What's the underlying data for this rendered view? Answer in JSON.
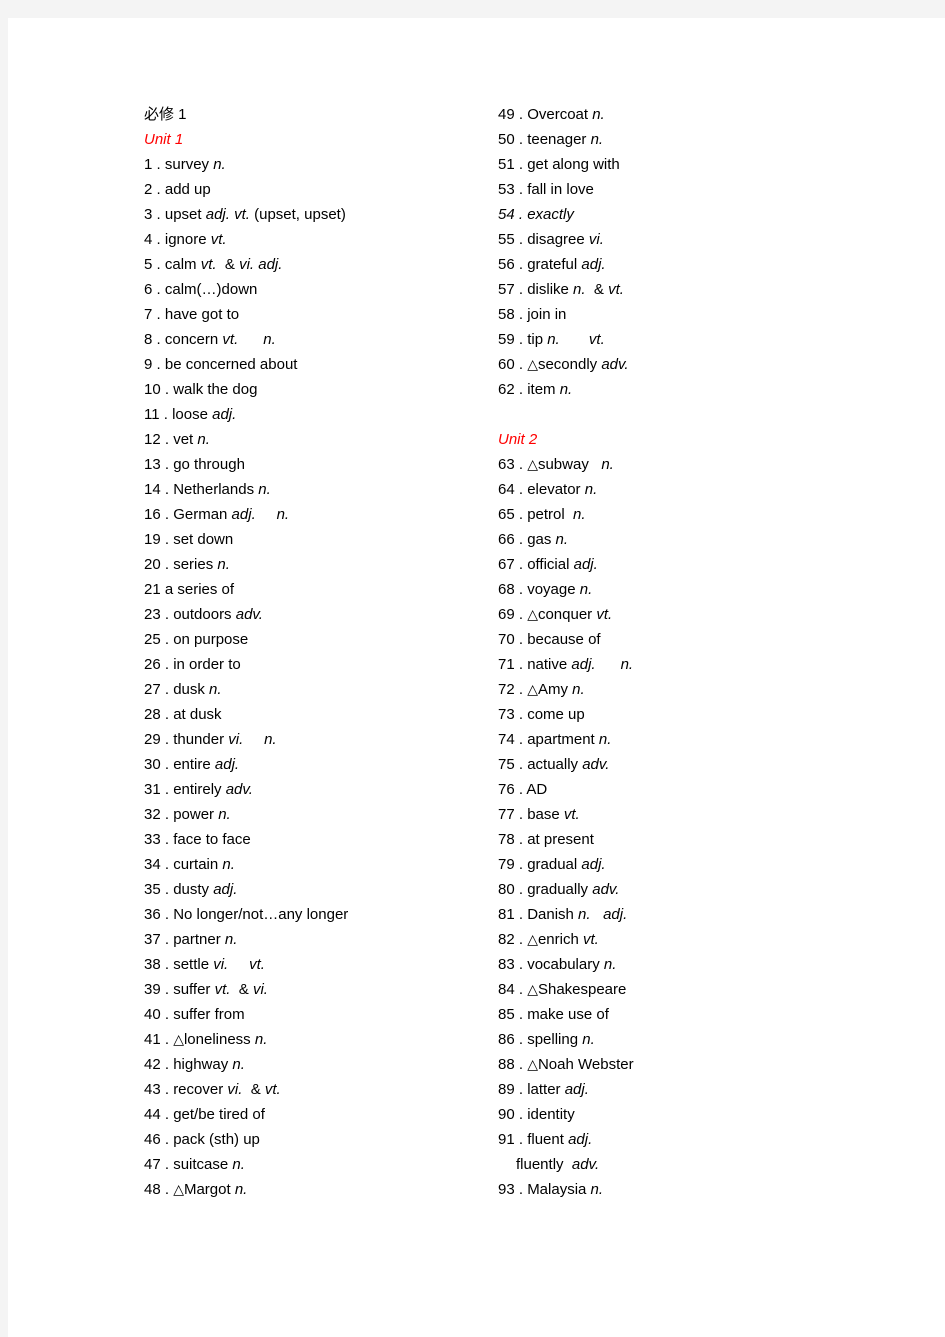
{
  "document": {
    "title": "必修 1",
    "accent_color": "#ff0000",
    "text_color": "#000000",
    "page_background": "#ffffff",
    "margin_background": "#f4f4f4",
    "marker_glyph": "△",
    "marker_meaning": "triangle-marker-icon"
  },
  "columns": {
    "left": {
      "unit_heading": "Unit 1",
      "entries": [
        {
          "num": "1",
          "sep": ".",
          "text": "survey n."
        },
        {
          "num": "2",
          "sep": ".",
          "text": "add up"
        },
        {
          "num": "3",
          "sep": ".",
          "text": "upset adj. vt. (upset, upset)"
        },
        {
          "num": "4",
          "sep": ".",
          "text": "ignore vt."
        },
        {
          "num": "5",
          "sep": ".",
          "text": "calm vt.  & vi. adj."
        },
        {
          "num": "6",
          "sep": ".",
          "text": "calm(…)down"
        },
        {
          "num": "7",
          "sep": ".",
          "text": "have got to"
        },
        {
          "num": "8",
          "sep": ".",
          "text": "concern vt.      n."
        },
        {
          "num": "9",
          "sep": ".",
          "text": "be concerned about"
        },
        {
          "num": "10",
          "sep": ".",
          "text": "walk the dog"
        },
        {
          "num": "11",
          "sep": ".",
          "text": "loose adj."
        },
        {
          "num": "12",
          "sep": ".",
          "text": "vet n."
        },
        {
          "num": "13",
          "sep": ".",
          "text": "go through"
        },
        {
          "num": "14",
          "sep": ".",
          "text": "Netherlands n."
        },
        {
          "num": "16",
          "sep": ".",
          "text": "German adj.     n."
        },
        {
          "num": "19",
          "sep": ".",
          "text": "set down"
        },
        {
          "num": "20",
          "sep": ".",
          "text": "series n."
        },
        {
          "num": "21",
          "sep": "",
          "text": "a series of"
        },
        {
          "num": "23",
          "sep": ".",
          "text": "outdoors adv."
        },
        {
          "num": "25",
          "sep": ".",
          "text": "on purpose"
        },
        {
          "num": "26",
          "sep": ".",
          "text": "in order to"
        },
        {
          "num": "27",
          "sep": ".",
          "text": "dusk n."
        },
        {
          "num": "28",
          "sep": ".",
          "text": "at dusk"
        },
        {
          "num": "29",
          "sep": ".",
          "text": "thunder vi.     n."
        },
        {
          "num": "30",
          "sep": ".",
          "text": "entire adj."
        },
        {
          "num": "31",
          "sep": ".",
          "text": "entirely adv."
        },
        {
          "num": "32",
          "sep": ".",
          "text": "power n."
        },
        {
          "num": "33",
          "sep": ".",
          "text": "face to face"
        },
        {
          "num": "34",
          "sep": ".",
          "text": "curtain n."
        },
        {
          "num": "35",
          "sep": ".",
          "text": "dusty adj."
        },
        {
          "num": "36",
          "sep": ".",
          "text": "No longer/not…any longer"
        },
        {
          "num": "37",
          "sep": ".",
          "text": "partner n."
        },
        {
          "num": "38",
          "sep": ".",
          "text": "settle vi.     vt."
        },
        {
          "num": "39",
          "sep": ".",
          "text": "suffer vt.  & vi."
        },
        {
          "num": "40",
          "sep": ".",
          "text": "suffer from"
        },
        {
          "num": "41",
          "sep": ".",
          "text": "△loneliness n."
        },
        {
          "num": "42",
          "sep": ".",
          "text": "highway n."
        },
        {
          "num": "43",
          "sep": ".",
          "text": "recover vi.  & vt."
        },
        {
          "num": "44",
          "sep": ".",
          "text": "get/be tired of"
        },
        {
          "num": "46",
          "sep": ".",
          "text": "pack (sth) up"
        },
        {
          "num": "47",
          "sep": ".",
          "text": "suitcase n."
        },
        {
          "num": "48",
          "sep": ".",
          "text": "△Margot n."
        }
      ]
    },
    "right": {
      "unit_heading": "Unit 2",
      "entries_before_unit2": [
        {
          "num": "49",
          "sep": ".",
          "text": "Overcoat n."
        },
        {
          "num": "50",
          "sep": ".",
          "text": "teenager n."
        },
        {
          "num": "51",
          "sep": ".",
          "text": "get along with"
        },
        {
          "num": "53",
          "sep": ".",
          "text": "fall in love"
        },
        {
          "num": "54",
          "sep": ".",
          "text": "exactly",
          "italic": true
        },
        {
          "num": "55",
          "sep": ".",
          "text": "disagree vi."
        },
        {
          "num": "56",
          "sep": ".",
          "text": "grateful adj."
        },
        {
          "num": "57",
          "sep": ".",
          "text": "dislike n.  & vt."
        },
        {
          "num": "58",
          "sep": ".",
          "text": "join in"
        },
        {
          "num": "59",
          "sep": ".",
          "text": "tip n.       vt."
        },
        {
          "num": "60",
          "sep": ".",
          "text": "△secondly adv."
        },
        {
          "num": "62",
          "sep": ".",
          "text": "item n."
        }
      ],
      "entries_after_unit2": [
        {
          "num": "63",
          "sep": ".",
          "text": "△subway   n."
        },
        {
          "num": "64",
          "sep": ".",
          "text": "elevator n."
        },
        {
          "num": "65",
          "sep": ".",
          "text": "petrol  n."
        },
        {
          "num": "66",
          "sep": ".",
          "text": "gas n."
        },
        {
          "num": "67",
          "sep": ".",
          "text": "official adj."
        },
        {
          "num": "68",
          "sep": ".",
          "text": "voyage n."
        },
        {
          "num": "69",
          "sep": ".",
          "text": "△conquer vt."
        },
        {
          "num": "70",
          "sep": ".",
          "text": "because of"
        },
        {
          "num": "71",
          "sep": ".",
          "text": "native adj.      n."
        },
        {
          "num": "72",
          "sep": ".",
          "text": "△Amy n."
        },
        {
          "num": "73",
          "sep": ".",
          "text": "come up"
        },
        {
          "num": "74",
          "sep": ".",
          "text": "apartment n."
        },
        {
          "num": "75",
          "sep": ".",
          "text": "actually adv."
        },
        {
          "num": "76",
          "sep": ".",
          "text": "AD"
        },
        {
          "num": "77",
          "sep": ".",
          "text": "base vt."
        },
        {
          "num": "78",
          "sep": ".",
          "text": "at present"
        },
        {
          "num": "79",
          "sep": ".",
          "text": "gradual adj."
        },
        {
          "num": "80",
          "sep": ".",
          "text": "gradually adv."
        },
        {
          "num": "81",
          "sep": ".",
          "text": "Danish n.   adj."
        },
        {
          "num": "82",
          "sep": ".",
          "text": "△enrich vt."
        },
        {
          "num": "83",
          "sep": ".",
          "text": "vocabulary n."
        },
        {
          "num": "84",
          "sep": ".",
          "text": "△Shakespeare"
        },
        {
          "num": "85",
          "sep": ".",
          "text": "make use of"
        },
        {
          "num": "86",
          "sep": ".",
          "text": "spelling n."
        },
        {
          "num": "88",
          "sep": ".",
          "text": "△Noah Webster"
        },
        {
          "num": "89",
          "sep": ".",
          "text": "latter adj."
        },
        {
          "num": "90",
          "sep": ".",
          "text": "identity"
        },
        {
          "num": "91",
          "sep": ".",
          "text": "fluent adj."
        },
        {
          "num": "",
          "sep": "",
          "text": "fluently  adv.",
          "continuation": true
        },
        {
          "num": "93",
          "sep": ".",
          "text": "Malaysia n."
        }
      ]
    }
  }
}
